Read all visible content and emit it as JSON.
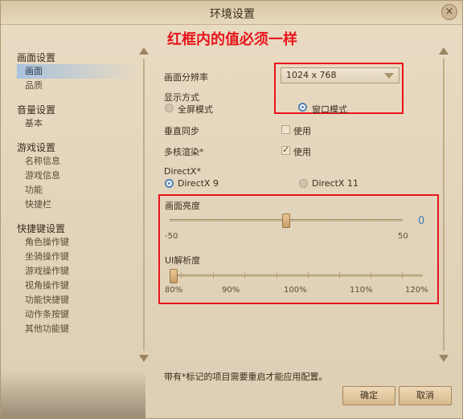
{
  "window": {
    "title": "环境设置",
    "close_label": "×"
  },
  "annotation": "红框内的值必须一样",
  "left_menu": [
    {
      "label": "画面设置",
      "items": [
        "画面",
        "品质"
      ]
    },
    {
      "label": "音量设置",
      "items": [
        "基本"
      ]
    },
    {
      "label": "游戏设置",
      "items": [
        "名称信息",
        "游戏信息",
        "功能",
        "快捷栏"
      ]
    },
    {
      "label": "快捷键设置",
      "items": [
        "角色操作键",
        "坐骑操作键",
        "游戏操作键",
        "视角操作键",
        "功能快捷键",
        "动作条按键",
        "其他功能键"
      ]
    }
  ],
  "settings": {
    "resolution": {
      "label": "画面分辨率",
      "value": "1024 x 768"
    },
    "display_mode": {
      "label": "显示方式",
      "option_full": "全屏模式",
      "option_window": "窗口模式",
      "selected": "窗口模式"
    },
    "vsync": {
      "label": "垂直同步",
      "option": "使用",
      "checked": false
    },
    "multicore": {
      "label": "多核渲染*",
      "option": "使用",
      "checked": true
    },
    "directx": {
      "label": "DirectX*",
      "option_9": "DirectX 9",
      "option_11": "DirectX 11",
      "selected": "DirectX 9"
    },
    "brightness": {
      "label": "画面亮度",
      "min": "-50",
      "max": "50",
      "value": "0",
      "value_num": 0
    },
    "ui_scale": {
      "label": "UI解析度",
      "ticks": [
        "80%",
        "90%",
        "100%",
        "110%",
        "120%"
      ],
      "value": "80%"
    }
  },
  "footer": {
    "note": "带有*标记的项目需要重启才能应用配置。",
    "ok_label": "确定",
    "cancel_label": "取消"
  },
  "colors": {
    "accent_red": "#e8141c",
    "accent_blue": "#3f7ab6",
    "panel_bg": "#e4d6bc"
  }
}
